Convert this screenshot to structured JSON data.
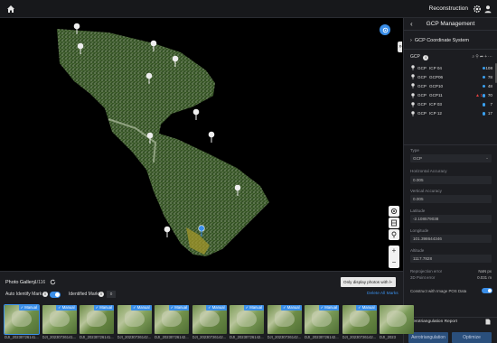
{
  "topbar": {
    "title": "Reconstruction",
    "home_icon": "home-icon",
    "settings_icon": "gear-icon",
    "user_icon": "user-icon"
  },
  "panel": {
    "title": "GCP Management",
    "coord_system_label": "GCP Coordinate System",
    "gcp_label": "GCP",
    "gcp_rows": [
      {
        "type": "GCP",
        "name": "ICP 04",
        "warn": "",
        "count": "108",
        "dot_color": "#3aa0f0"
      },
      {
        "type": "GCP",
        "name": "GCP06",
        "warn": "",
        "count": "78",
        "dot_color": "#3aa0f0"
      },
      {
        "type": "GCP",
        "name": "GCP10",
        "warn": "",
        "count": "48",
        "dot_color": "#3aa0f0"
      },
      {
        "type": "GCP",
        "name": "GCP11",
        "warn": "1",
        "count": "70",
        "dot_color": "#3aa0f0"
      },
      {
        "type": "GCP",
        "name": "ICP 03",
        "warn": "",
        "count": "7",
        "dot_color": "#3aa0f0"
      },
      {
        "type": "GCP",
        "name": "ICP 12",
        "warn": "",
        "count": "17",
        "dot_color": "#3aa0f0"
      }
    ],
    "type_label": "Type",
    "type_value": "GCP",
    "horizontal_accuracy_label": "Horizontal Accuracy",
    "horizontal_accuracy_value": "0.005",
    "vertical_accuracy_label": "Vertical Accuracy",
    "vertical_accuracy_value": "0.005",
    "latitude_label": "Latitude",
    "latitude_value": "-2.108579038",
    "longitude_label": "Longitude",
    "longitude_value": "101.398644346",
    "altitude_label": "Altitude",
    "altitude_value": "1117.7828",
    "reprojection_label": "Reprojection error",
    "reprojection_value": "NaN px",
    "point_error_label": "3D Point error",
    "point_error_value": "0.031 m",
    "construct_label": "Construct with Image POS Data",
    "aerotriangulation_label": "Aerotriangulation Report",
    "aerotriangulation_button": "Aerotriangulation",
    "optimize_button": "Optimize"
  },
  "gallery": {
    "title": "Photo Gallery",
    "count": "1/116",
    "filter_value": "Only display photos with l",
    "auto_identify_label": "Auto Identify Mark",
    "identified_marks_label": "Identified Marks",
    "identified_marks_count": "0",
    "delete_all_label": "Delete All Marks",
    "photos": [
      {
        "badge": "Manual",
        "filename": "DJI_20230726141..."
      },
      {
        "badge": "Manual",
        "filename": "DJI_20230726141..."
      },
      {
        "badge": "Manual",
        "filename": "DJI_20230726141..."
      },
      {
        "badge": "Manual",
        "filename": "DJI_20230726142..."
      },
      {
        "badge": "Manual",
        "filename": "DJI_20230726142..."
      },
      {
        "badge": "Manual",
        "filename": "DJI_20230726142..."
      },
      {
        "badge": "Manual",
        "filename": "DJI_20230726142..."
      },
      {
        "badge": "Manual",
        "filename": "DJI_20230726142..."
      },
      {
        "badge": "Manual",
        "filename": "DJI_20230726142..."
      },
      {
        "badge": "Manual",
        "filename": "DJI_20230726142..."
      },
      {
        "badge": "",
        "filename": "DJI_2023"
      }
    ]
  },
  "colors": {
    "accent": "#3a8ee8",
    "warning": "#e04040",
    "panel_bg": "#1c1d21"
  }
}
